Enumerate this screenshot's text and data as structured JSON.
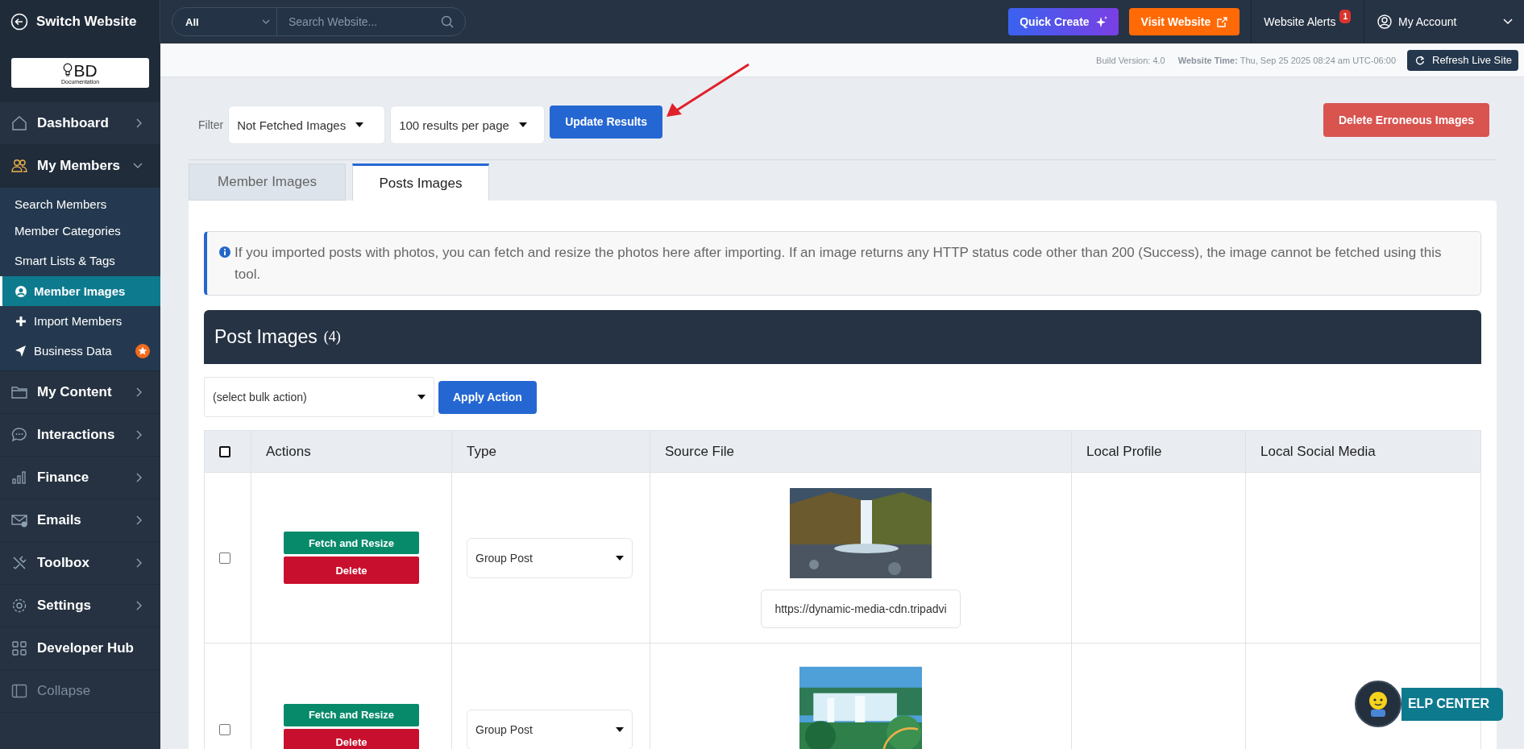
{
  "topbar": {
    "switch_label": "Switch Website",
    "search_scope": "All",
    "search_placeholder": "Search Website...",
    "quick_create": "Quick Create",
    "visit_website": "Visit Website",
    "alerts_label": "Website Alerts",
    "alerts_count": "1",
    "account_label": "My Account"
  },
  "logo": {
    "text": "BD",
    "subtitle": "Documentation"
  },
  "info_bar": {
    "build": "Build Version: 4.0",
    "time_label": "Website Time:",
    "time_value": "Thu, Sep 25 2025 08:24 am UTC-06:00",
    "refresh": "Refresh Live Site"
  },
  "sidebar": {
    "items": [
      {
        "label": "Dashboard",
        "expanded": false
      },
      {
        "label": "My Members",
        "expanded": true,
        "children": [
          {
            "label": "Search Members",
            "selected": false,
            "badge": false
          },
          {
            "label": "Member Categories",
            "selected": false,
            "badge": false
          },
          {
            "label": "Smart Lists & Tags",
            "selected": false,
            "badge": false
          },
          {
            "label": "Member Images",
            "selected": true,
            "badge": false
          },
          {
            "label": "Import Members",
            "selected": false,
            "badge": false
          },
          {
            "label": "Business Data",
            "selected": false,
            "badge": true
          }
        ]
      },
      {
        "label": "My Content",
        "expanded": false
      },
      {
        "label": "Interactions",
        "expanded": false
      },
      {
        "label": "Finance",
        "expanded": false
      },
      {
        "label": "Emails",
        "expanded": false
      },
      {
        "label": "Toolbox",
        "expanded": false
      },
      {
        "label": "Settings",
        "expanded": false
      },
      {
        "label": "Developer Hub"
      }
    ],
    "collapse": "Collapse"
  },
  "filter": {
    "label": "Filter",
    "status": "Not Fetched Images",
    "per_page": "100 results per page",
    "update": "Update Results",
    "delete_erroneous": "Delete Erroneous Images"
  },
  "tabs": [
    {
      "label": "Member Images",
      "selected": false
    },
    {
      "label": "Posts Images",
      "selected": true
    }
  ],
  "notice": "If you imported posts with photos, you can fetch and resize the photos here after importing. If an image returns any HTTP status code other than 200 (Success), the image cannot be fetched using this tool.",
  "panel": {
    "title": "Post Images",
    "count": "(4)",
    "bulk_placeholder": "(select bulk action)",
    "apply": "Apply Action"
  },
  "table": {
    "select_all_checked": false,
    "columns": [
      "Actions",
      "Type",
      "Source File",
      "Local Profile",
      "Local Social Media"
    ],
    "rows": [
      {
        "checked": false,
        "actions": [
          "Fetch and Resize",
          "Delete"
        ],
        "type": "Group Post",
        "source_url": "https://dynamic-media-cdn.tripadvi"
      },
      {
        "checked": false,
        "actions": [
          "Fetch and Resize",
          "Delete"
        ],
        "type": "Group Post"
      }
    ]
  },
  "help": {
    "label": "ELP CENTER"
  }
}
